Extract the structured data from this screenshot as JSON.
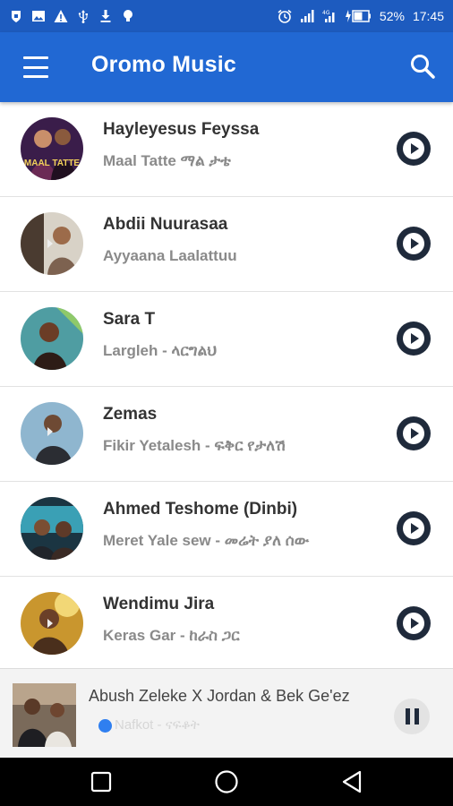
{
  "status_bar": {
    "left_icons": [
      "shield-notification-icon",
      "image-icon",
      "warning-icon",
      "usb-icon",
      "download-icon",
      "bulb-icon"
    ],
    "right_icons": [
      "alarm-icon",
      "signal-icon",
      "signal-4g-icon",
      "battery-charging-icon"
    ],
    "battery": "52%",
    "time": "17:45"
  },
  "app_bar": {
    "title": "Oromo Music",
    "menu_icon": "hamburger-menu-icon",
    "search_icon": "search-icon"
  },
  "songs": [
    {
      "artist": "Hayleyesus Feyssa",
      "title": "Maal Tatte ማል ታቴ",
      "thumb_text": "MAAL TATTE"
    },
    {
      "artist": "Abdii Nuurasaa",
      "title": "Ayyaana Laalattuu"
    },
    {
      "artist": "Sara T",
      "title": "Largleh - ላርግልህ"
    },
    {
      "artist": "Zemas",
      "title": "Fikir Yetalesh - ፍቅር የታለሽ"
    },
    {
      "artist": "Ahmed Teshome (Dinbi)",
      "title": "Meret Yale sew - መሬት ያለ ሰው"
    },
    {
      "artist": "Wendimu Jira",
      "title": "Keras Gar - ከራስ ጋር"
    }
  ],
  "now_playing": {
    "title": "Abush Zeleke X Jordan & Bek Ge'ez",
    "subtitle": "Nafkot - ናፍቆት",
    "state": "playing"
  },
  "nav_bar": {
    "buttons": [
      "recents-square-icon",
      "home-circle-icon",
      "back-triangle-icon"
    ]
  },
  "colors": {
    "primary": "#2168d3",
    "status_bar": "#1d5bbf",
    "play_button": "#1f2a3b",
    "loader": "#2f7ff0"
  }
}
